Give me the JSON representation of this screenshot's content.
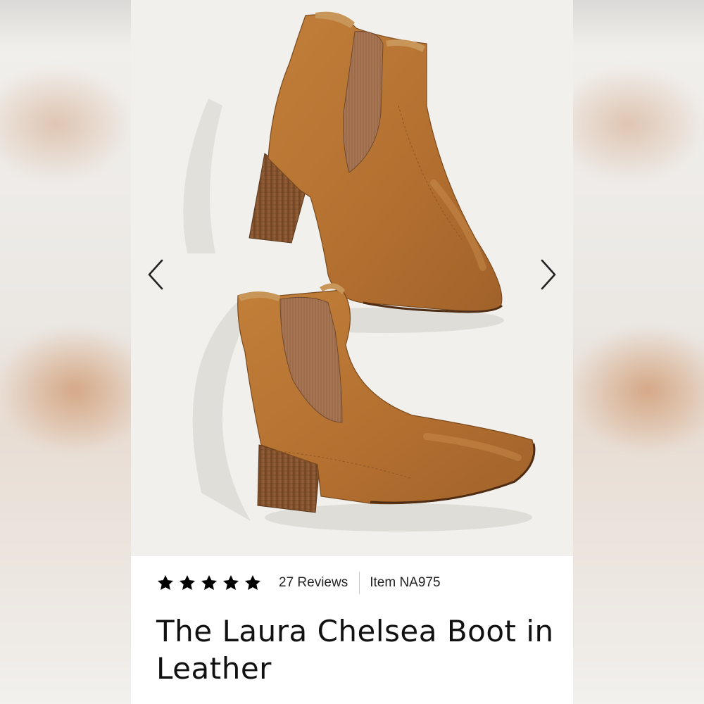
{
  "product": {
    "rating_stars": 5,
    "reviews_label": "27 Reviews",
    "item_label": "Item NA975",
    "title": "The Laura Chelsea Boot in Leather",
    "image_alt": "Pair of tan leather Chelsea boots with stacked heels"
  },
  "carousel": {
    "prev_icon": "chevron-left-icon",
    "next_icon": "chevron-right-icon"
  },
  "colors": {
    "boot_leather": "#b5742f",
    "boot_elastic": "#9c6b47",
    "heel_wood": "#8a5a32",
    "image_background": "#f1f0ed"
  }
}
